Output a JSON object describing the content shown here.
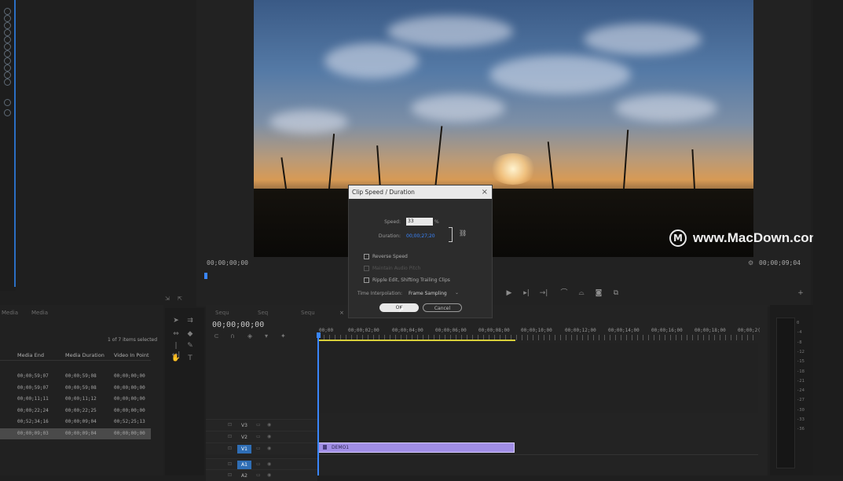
{
  "program_monitor": {
    "timecode_in": "00;00;00;00",
    "timecode_out": "00;00;09;04"
  },
  "watermark": {
    "logo_letter": "M",
    "text": "www.MacDown.com"
  },
  "dialog": {
    "title": "Clip Speed / Duration",
    "close_icon": "×",
    "speed_label": "Speed:",
    "speed_value": "33",
    "speed_unit": "%",
    "duration_label": "Duration:",
    "duration_value": "00;00;27;20",
    "reverse_speed_label": "Reverse Speed",
    "maintain_audio_label": "Maintain Audio Pitch",
    "ripple_edit_label": "Ripple Edit, Shifting Trailing Clips",
    "time_interp_label": "Time Interpolation:",
    "time_interp_value": "Frame Sampling",
    "ok_label": "OK",
    "cancel_label": "Cancel"
  },
  "project": {
    "tabs": [
      "Media",
      "Media"
    ],
    "selection_info": "1 of 7 items selected",
    "columns": [
      "Media End",
      "Media Duration",
      "Video In Point"
    ],
    "rows": [
      [
        "00;00;59;07",
        "00;00;59;08",
        "00;00;00;00"
      ],
      [
        "00;00;59;07",
        "00;00;59;08",
        "00;00;00;00"
      ],
      [
        "00;00;11;11",
        "00;00;11;12",
        "00;00;00;00"
      ],
      [
        "00;00;22;24",
        "00;00;22;25",
        "00;00;00;00"
      ],
      [
        "00;52;34;16",
        "00;00;09;04",
        "00;52;25;13"
      ],
      [
        "00;00;09;03",
        "00;00;09;04",
        "00;00;00;00"
      ]
    ]
  },
  "timeline": {
    "tabs": [
      "Sequ",
      "Seq",
      "Sequ"
    ],
    "timecode": "00;00;00;00",
    "ruler_labels": [
      "00;00",
      "00;00;02;00",
      "00;00;04;00",
      "00;00;06;00",
      "00;00;08;00",
      "00;00;10;00",
      "00;00;12;00",
      "00;00;14;00",
      "00;00;16;00",
      "00;00;18;00",
      "00;00;2("
    ],
    "tracks": [
      "V3",
      "V2",
      "V1",
      "A1",
      "A2"
    ],
    "clip_name": "DEMO1"
  },
  "meters": {
    "labels": [
      "0",
      "-4",
      "-8",
      "-12",
      "-15",
      "-18",
      "-21",
      "-24",
      "-27",
      "-30",
      "-33",
      "-36"
    ]
  },
  "colors": {
    "accent_blue": "#3a86ff",
    "clip_purple": "#a18ee6",
    "work_area_yellow": "#d8cf3a"
  }
}
